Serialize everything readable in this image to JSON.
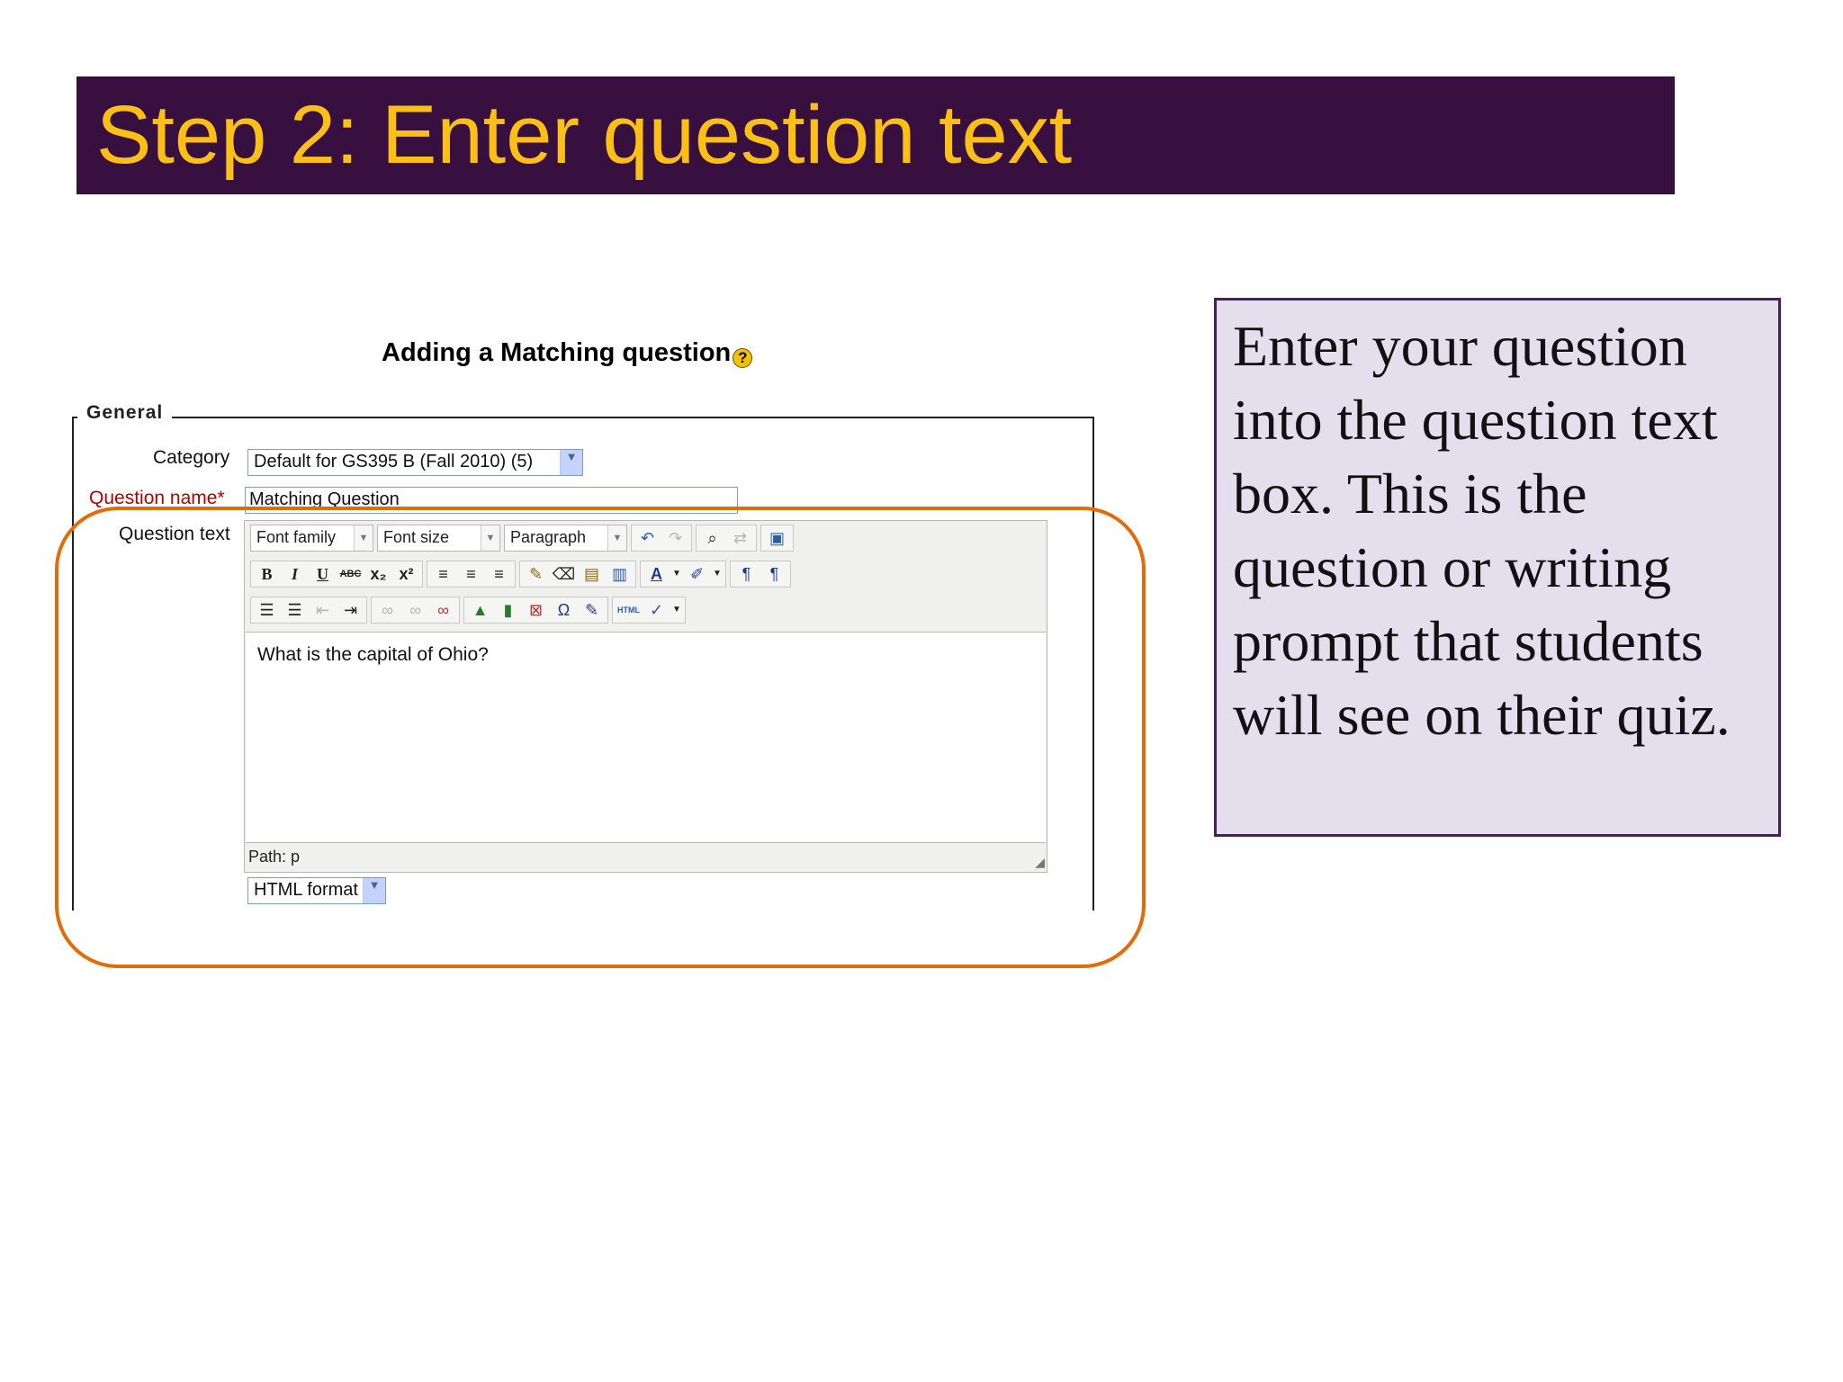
{
  "slide": {
    "title": "Step 2: Enter question text",
    "callout": "Enter your question into the question text box.  This is the question or writing prompt that students will see on their quiz."
  },
  "form": {
    "heading": "Adding a Matching question",
    "help_icon": "?",
    "legend": "General",
    "category_label": "Category",
    "category_value": "Default for GS395 B (Fall 2010) (5)",
    "question_name_label": "Question name*",
    "question_name_value": "Matching Question",
    "question_text_label": "Question text",
    "format_value": "HTML format"
  },
  "editor": {
    "font_family": "Font family",
    "font_size": "Font size",
    "paragraph": "Paragraph",
    "content": "What is the capital of Ohio?",
    "path": "Path: p"
  },
  "colors": {
    "title_bg": "#37103f",
    "title_text": "#fbbf16",
    "callout_bg": "#e4dfed",
    "highlight": "#e36c09"
  }
}
